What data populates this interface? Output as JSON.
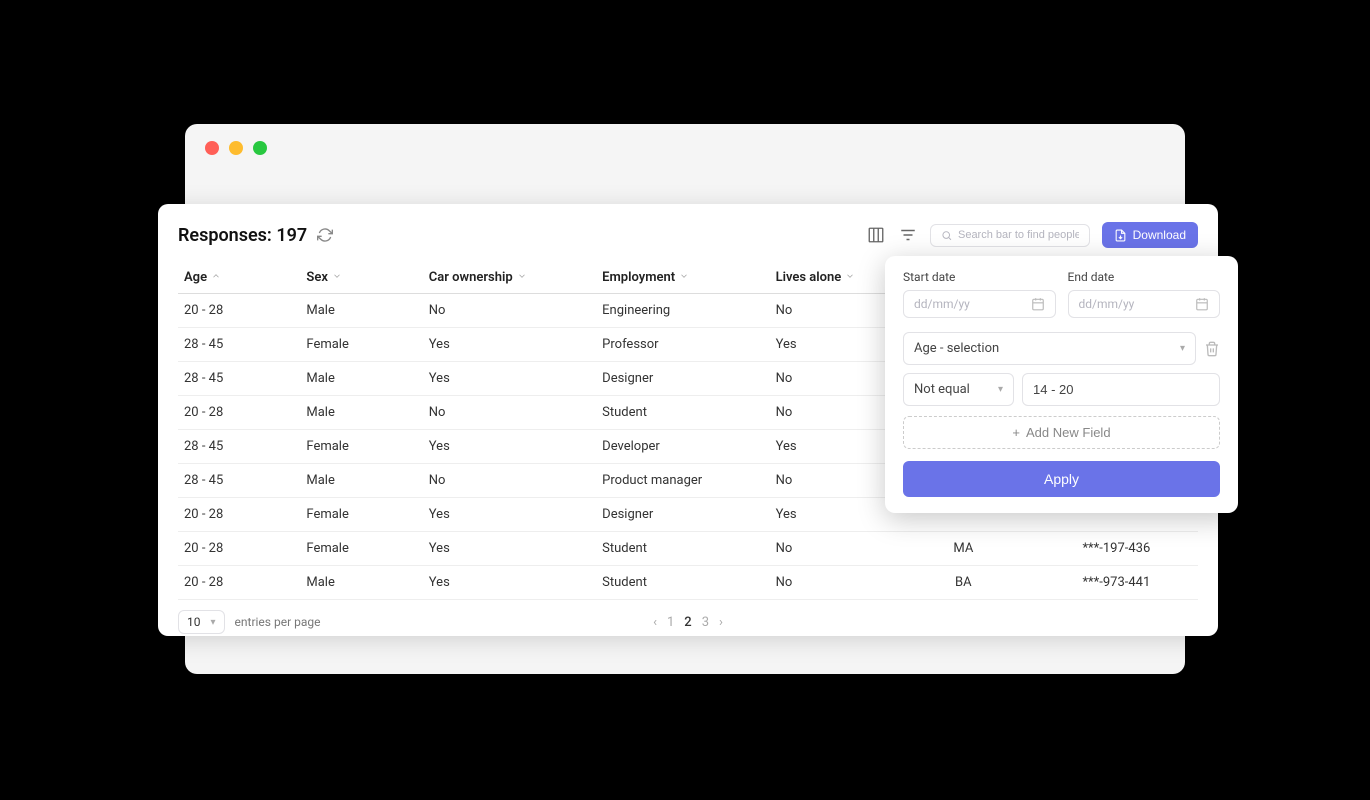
{
  "header": {
    "responses_label": "Responses:",
    "responses_count": "197",
    "search_placeholder": "Search bar to find people",
    "download_label": "Download"
  },
  "columns": [
    {
      "label": "Age",
      "sort": "asc"
    },
    {
      "label": "Sex",
      "sort": "none"
    },
    {
      "label": "Car ownership",
      "sort": "none"
    },
    {
      "label": "Employment",
      "sort": "none"
    },
    {
      "label": "Lives alone",
      "sort": "none"
    },
    {
      "label": "",
      "sort": "hidden"
    },
    {
      "label": "",
      "sort": "hidden"
    }
  ],
  "rows": [
    {
      "age": "20 - 28",
      "sex": "Male",
      "car": "No",
      "emp": "Engineering",
      "alone": "No",
      "edu": "",
      "phone": ""
    },
    {
      "age": "28 - 45",
      "sex": "Female",
      "car": "Yes",
      "emp": "Professor",
      "alone": "Yes",
      "edu": "",
      "phone": ""
    },
    {
      "age": "28 - 45",
      "sex": "Male",
      "car": "Yes",
      "emp": "Designer",
      "alone": "No",
      "edu": "",
      "phone": ""
    },
    {
      "age": "20 - 28",
      "sex": "Male",
      "car": "No",
      "emp": "Student",
      "alone": "No",
      "edu": "",
      "phone": ""
    },
    {
      "age": "28 - 45",
      "sex": "Female",
      "car": "Yes",
      "emp": "Developer",
      "alone": "Yes",
      "edu": "",
      "phone": ""
    },
    {
      "age": "28 - 45",
      "sex": "Male",
      "car": "No",
      "emp": "Product manager",
      "alone": "No",
      "edu": "",
      "phone": ""
    },
    {
      "age": "20 - 28",
      "sex": "Female",
      "car": "Yes",
      "emp": "Designer",
      "alone": "Yes",
      "edu": "",
      "phone": ""
    },
    {
      "age": "20 - 28",
      "sex": "Female",
      "car": "Yes",
      "emp": "Student",
      "alone": "No",
      "edu": "MA",
      "phone": "***-197-436"
    },
    {
      "age": "20 - 28",
      "sex": "Male",
      "car": "Yes",
      "emp": "Student",
      "alone": "No",
      "edu": "BA",
      "phone": "***-973-441"
    }
  ],
  "footer": {
    "entries_value": "10",
    "entries_label": "entries per page",
    "pages": [
      "1",
      "2",
      "3"
    ],
    "active_page": 1
  },
  "filter_popover": {
    "start_date_label": "Start date",
    "end_date_label": "End date",
    "date_placeholder": "dd/mm/yy",
    "field_select_value": "Age - selection",
    "operator_value": "Not equal",
    "value_input": "14 - 20",
    "add_field_label": "Add New Field",
    "apply_label": "Apply"
  }
}
